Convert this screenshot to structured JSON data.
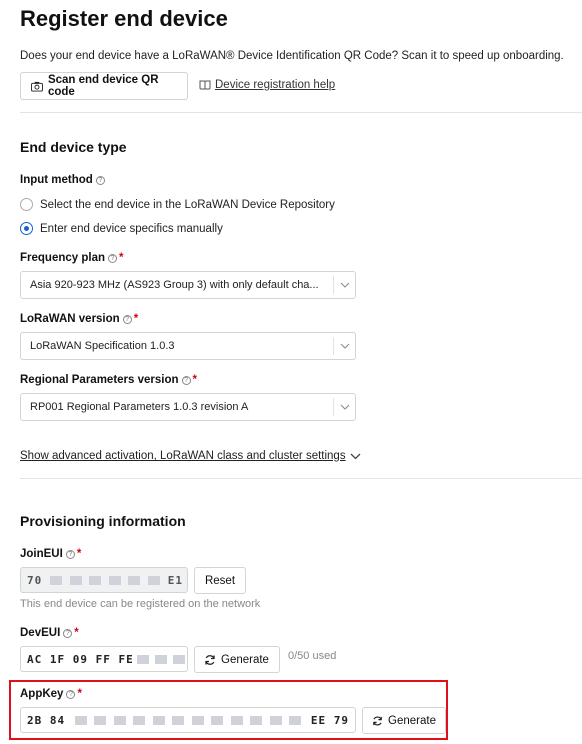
{
  "header": {
    "title": "Register end device",
    "description": "Does your end device have a LoRaWAN® Device Identification QR Code? Scan it to speed up onboarding.",
    "scan_button": "Scan end device QR code",
    "help_link": "Device registration help"
  },
  "device_type": {
    "section_title": "End device type",
    "input_method_label": "Input method",
    "options": [
      {
        "label": "Select the end device in the LoRaWAN Device Repository",
        "checked": false
      },
      {
        "label": "Enter end device specifics manually",
        "checked": true
      }
    ],
    "frequency_plan_label": "Frequency plan",
    "frequency_plan_value": "Asia 920-923 MHz (AS923 Group 3) with only default cha...",
    "lorawan_version_label": "LoRaWAN version",
    "lorawan_version_value": "LoRaWAN Specification 1.0.3",
    "regional_params_label": "Regional Parameters version",
    "regional_params_value": "RP001 Regional Parameters 1.0.3 revision A",
    "advanced_link": "Show advanced activation, LoRaWAN class and cluster settings"
  },
  "provisioning": {
    "section_title": "Provisioning information",
    "joineui_label": "JoinEUI",
    "joineui_prefix": "70",
    "joineui_suffix": "E1",
    "reset_button": "Reset",
    "joineui_hint": "This end device can be registered on the network",
    "deveui_label": "DevEUI",
    "deveui_prefix": "AC 1F 09 FF FE",
    "generate_button": "Generate",
    "deveui_counter": "0/50 used",
    "appkey_label": "AppKey",
    "appkey_prefix": "2B 84",
    "appkey_suffix": "EE 79",
    "appkey_generate_button": "Generate"
  },
  "colors": {
    "accent": "#1a5ed6",
    "highlight": "#e0101a",
    "required": "#d0021b"
  }
}
